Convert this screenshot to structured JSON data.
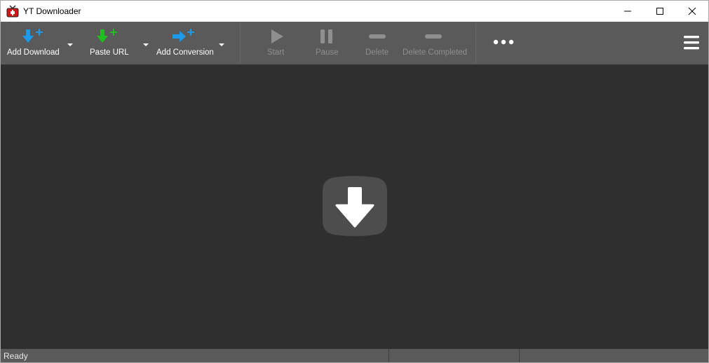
{
  "app": {
    "title": "YT Downloader"
  },
  "window_controls": {
    "minimize": "minimize-icon",
    "maximize": "maximize-icon",
    "close": "close-icon"
  },
  "toolbar": {
    "add_download": "Add Download",
    "paste_url": "Paste URL",
    "add_conversion": "Add Conversion",
    "start": "Start",
    "pause": "Pause",
    "delete": "Delete",
    "delete_completed": "Delete Completed",
    "more": "more-icon",
    "menu": "hamburger-menu-icon"
  },
  "colors": {
    "toolbar_bg": "#5a5a5a",
    "content_bg": "#2f2f2f",
    "accent_blue": "#1e9be8",
    "accent_green": "#1fbf1f",
    "disabled": "#8f8f8f"
  },
  "status": {
    "text": "Ready"
  }
}
